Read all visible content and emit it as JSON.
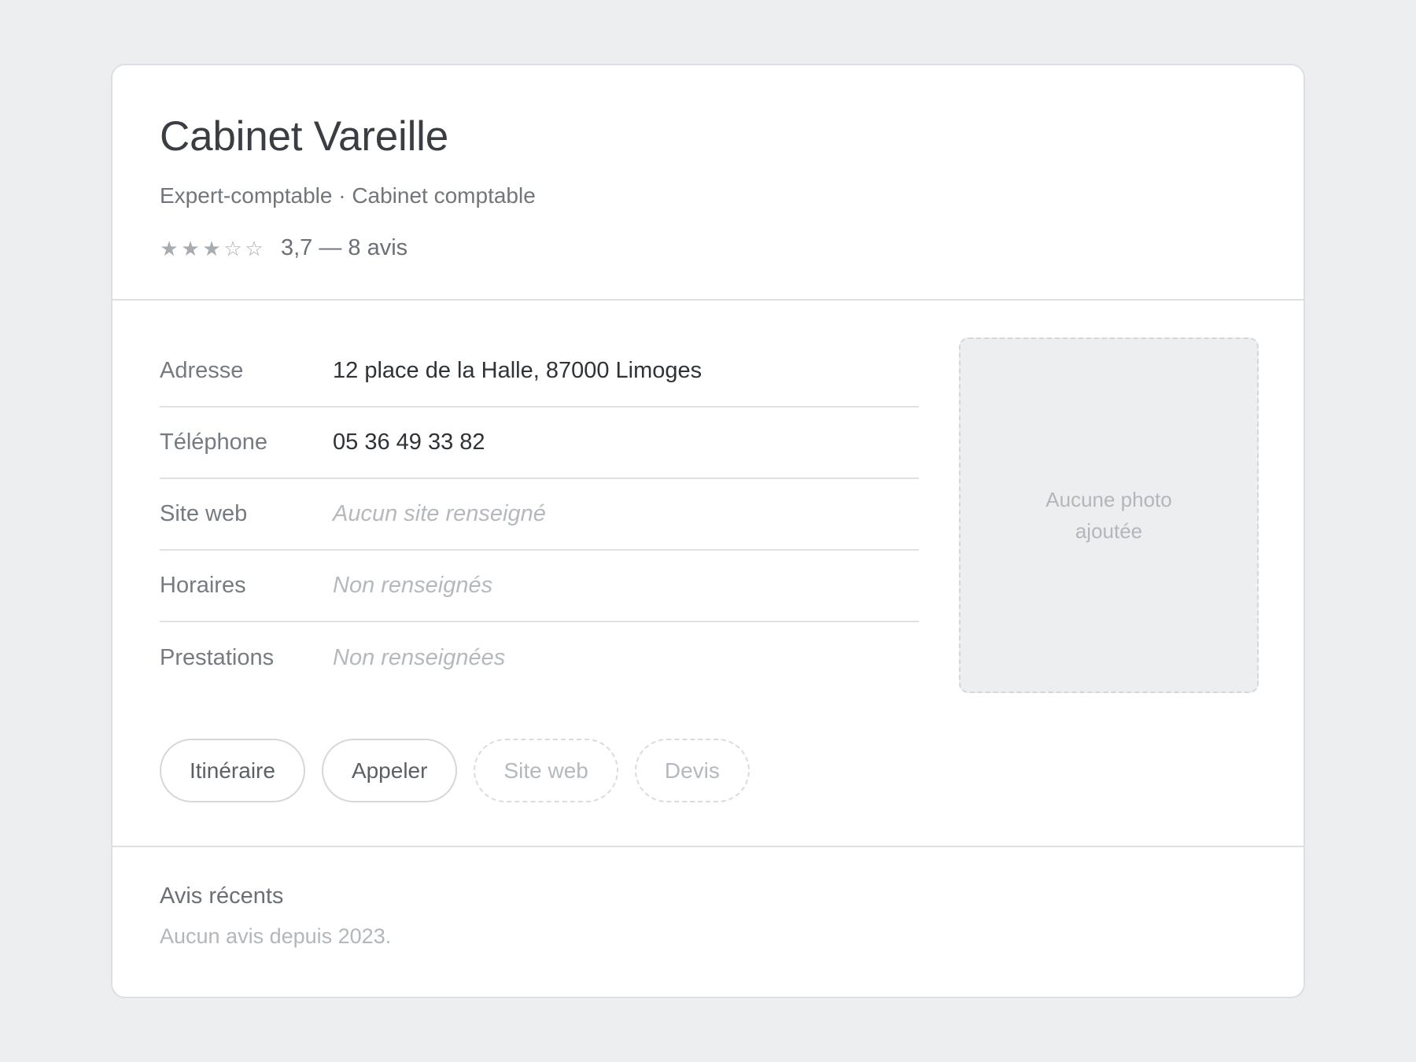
{
  "business": {
    "name": "Cabinet Vareille",
    "category": "Expert-comptable · Cabinet comptable",
    "rating": {
      "value": 3.7,
      "stars": [
        "★",
        "★",
        "★",
        "☆",
        "☆"
      ],
      "text": "3,7 — 8 avis"
    }
  },
  "details": [
    {
      "label": "Adresse",
      "value": "12 place de la Halle, 87000 Limoges",
      "empty": false
    },
    {
      "label": "Téléphone",
      "value": "05 36 49 33 82",
      "empty": false
    },
    {
      "label": "Site web",
      "value": "Aucun site renseigné",
      "empty": true
    },
    {
      "label": "Horaires",
      "value": "Non renseignés",
      "empty": true
    },
    {
      "label": "Prestations",
      "value": "Non renseignées",
      "empty": true
    }
  ],
  "photo": {
    "placeholder": "Aucune photo ajoutée"
  },
  "actions": [
    {
      "label": "Itinéraire",
      "enabled": true
    },
    {
      "label": "Appeler",
      "enabled": true
    },
    {
      "label": "Site web",
      "enabled": false
    },
    {
      "label": "Devis",
      "enabled": false
    }
  ],
  "reviews": {
    "title": "Avis récents",
    "empty_text": "Aucun avis depuis 2023."
  },
  "colors": {
    "background": "#eceef0",
    "card": "#ffffff",
    "border": "#dcdfe3",
    "star": "#a7acb1"
  }
}
